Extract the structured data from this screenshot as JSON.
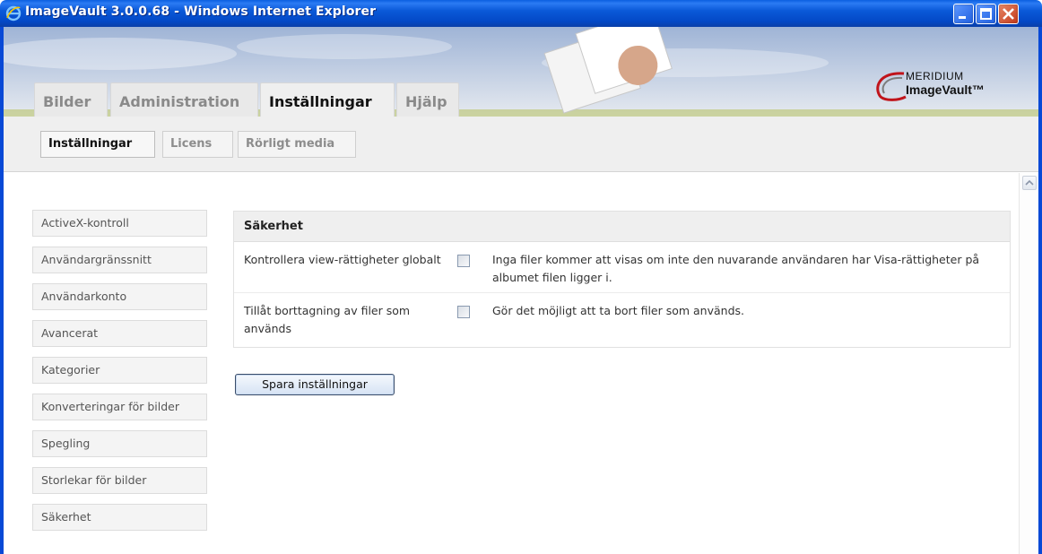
{
  "window": {
    "title": "ImageVault 3.0.0.68 - Windows Internet Explorer"
  },
  "logo": {
    "line1": "MERIDIUM",
    "line2": "ImageVault™"
  },
  "main_tabs": [
    {
      "label": "Bilder",
      "active": false
    },
    {
      "label": "Administration",
      "active": false
    },
    {
      "label": "Inställningar",
      "active": true
    },
    {
      "label": "Hjälp",
      "active": false
    }
  ],
  "sub_tabs": [
    {
      "label": "Inställningar",
      "active": true
    },
    {
      "label": "Licens",
      "active": false
    },
    {
      "label": "Rörligt media",
      "active": false
    }
  ],
  "left_nav": [
    "ActiveX-kontroll",
    "Användargränssnitt",
    "Användarkonto",
    "Avancerat",
    "Kategorier",
    "Konverteringar för bilder",
    "Spegling",
    "Storlekar för bilder",
    "Säkerhet"
  ],
  "panel": {
    "header": "Säkerhet",
    "rows": [
      {
        "label": "Kontrollera view-rättigheter globalt",
        "checked": false,
        "description": "Inga filer kommer att visas om inte den nuvarande användaren har Visa-rättigheter på albumet filen ligger i."
      },
      {
        "label": "Tillåt borttagning av filer som används",
        "checked": false,
        "description": "Gör det möjligt att ta bort filer som används."
      }
    ]
  },
  "save_button": "Spara inställningar",
  "colors": {
    "titlebar": "#0a59d8",
    "panel_header_bg": "#efefef",
    "nav_item_bg": "#f4f4f4"
  }
}
